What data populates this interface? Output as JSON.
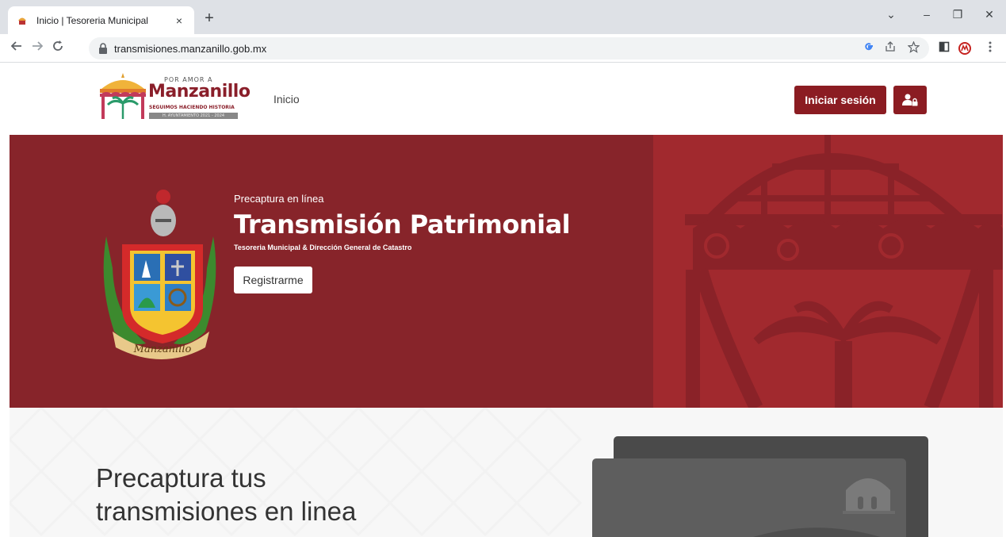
{
  "browser": {
    "tab_title": "Inicio | Tesoreria Municipal",
    "tab_close": "×",
    "new_tab": "+",
    "url": "transmisiones.manzanillo.gob.mx",
    "win_controls": {
      "chevron": "⌄",
      "minimize": "–",
      "restore": "❐",
      "close": "✕"
    }
  },
  "header": {
    "logo": {
      "top": "POR AMOR A",
      "name": "Manzanillo",
      "tagline": "SEGUIMOS HACIENDO HISTORIA",
      "period": "H. AYUNTAMIENTO 2021 - 2024"
    },
    "nav_inicio": "Inicio",
    "login_label": "Iniciar sesión"
  },
  "hero": {
    "kicker": "Precaptura en línea",
    "title": "Transmisión Patrimonial",
    "subtitle": "Tesoreria Municipal & Dirección General de Catastro",
    "register_label": "Registrarme",
    "crest_ribbon": "Manzanillo"
  },
  "lower": {
    "title": "Precaptura tus transmisiones en linea"
  },
  "colors": {
    "brand": "#8b1c22",
    "hero_bg": "#87242a",
    "hero_right": "#a1292e"
  }
}
